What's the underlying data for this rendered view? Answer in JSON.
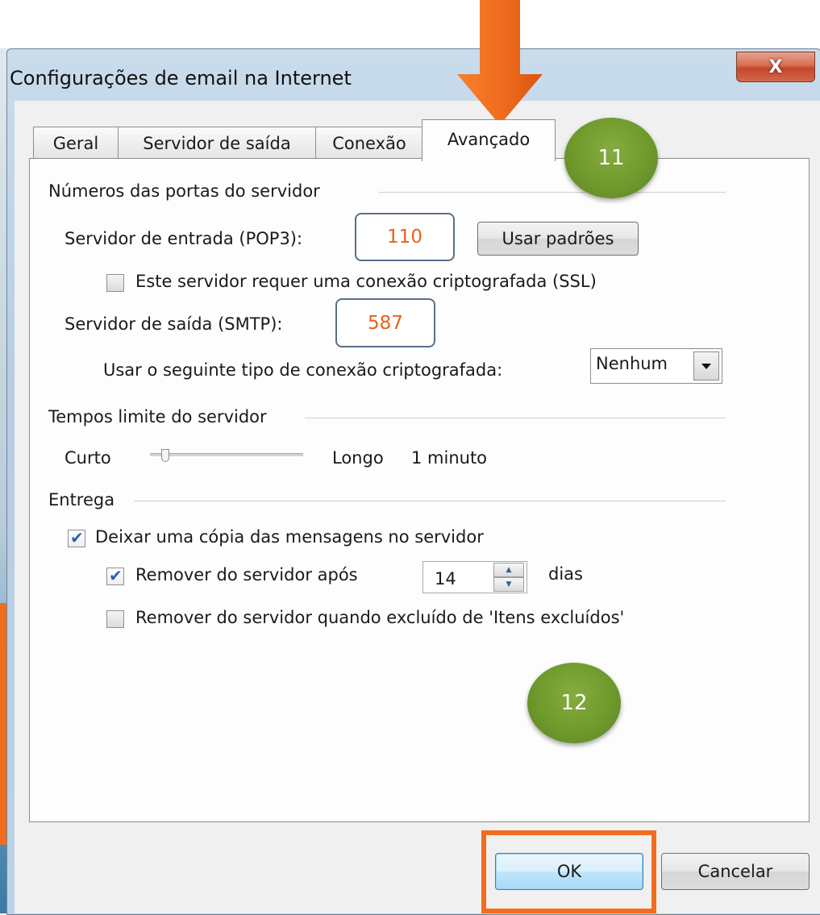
{
  "window": {
    "title": "Configurações de email na Internet",
    "close_glyph": "X"
  },
  "tabs": [
    {
      "label": "Geral",
      "active": false
    },
    {
      "label": "Servidor de saída",
      "active": false
    },
    {
      "label": "Conexão",
      "active": false
    },
    {
      "label": "Avançado",
      "active": true
    }
  ],
  "ports": {
    "section_title": "Números das portas do servidor",
    "incoming_label": "Servidor de entrada (POP3):",
    "incoming_value": "110",
    "use_defaults_label": "Usar padrões",
    "ssl_label": "Este servidor requer uma conexão criptografada (SSL)",
    "ssl_checked": false,
    "outgoing_label": "Servidor de saída (SMTP):",
    "outgoing_value": "587",
    "encryption_label": "Usar o seguinte tipo de conexão criptografada:",
    "encryption_value": "Nenhum"
  },
  "timeouts": {
    "section_title": "Tempos limite do servidor",
    "short_label": "Curto",
    "long_label": "Longo",
    "value_text": "1 minuto"
  },
  "delivery": {
    "section_title": "Entrega",
    "leave_copy_label": "Deixar uma cópia das mensagens no servidor",
    "leave_copy_checked": true,
    "remove_after_label": "Remover do servidor após",
    "remove_after_checked": true,
    "remove_after_days": "14",
    "days_label": "dias",
    "remove_deleted_label": "Remover do servidor quando excluído de 'Itens excluídos'",
    "remove_deleted_checked": false
  },
  "footer": {
    "ok_label": "OK",
    "cancel_label": "Cancelar"
  },
  "annotations": {
    "step_11": "11",
    "step_12": "12",
    "accent_color": "#f26c1f",
    "circle_color": "#6f9a2c"
  }
}
